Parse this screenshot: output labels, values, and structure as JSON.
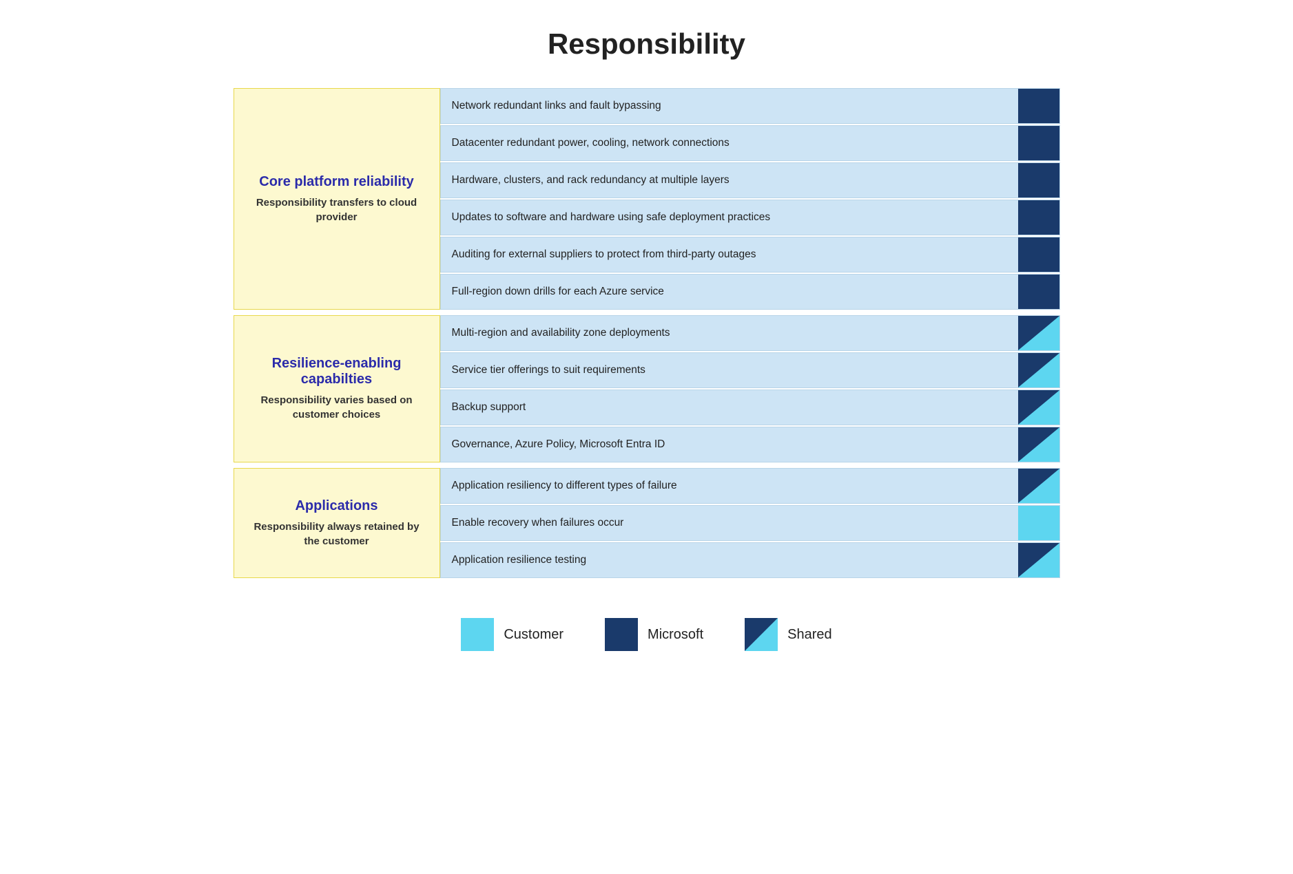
{
  "title": "Responsibility",
  "sections": [
    {
      "id": "core-platform",
      "title": "Core platform reliability",
      "subtitle": "Responsibility transfers\nto cloud provider",
      "items": [
        {
          "text": "Network redundant links and fault bypassing",
          "indicator": "microsoft"
        },
        {
          "text": "Datacenter redundant power, cooling, network connections",
          "indicator": "microsoft"
        },
        {
          "text": "Hardware, clusters, and rack redundancy at multiple layers",
          "indicator": "microsoft"
        },
        {
          "text": "Updates to software and hardware using safe deployment practices",
          "indicator": "microsoft"
        },
        {
          "text": "Auditing for external suppliers to protect from third-party outages",
          "indicator": "microsoft"
        },
        {
          "text": "Full-region down drills for each Azure service",
          "indicator": "microsoft"
        }
      ]
    },
    {
      "id": "resilience-enabling",
      "title": "Resilience-enabling capabilties",
      "subtitle": "Responsibility varies based\non customer choices",
      "items": [
        {
          "text": "Multi-region and availability zone deployments",
          "indicator": "shared"
        },
        {
          "text": "Service tier offerings to suit requirements",
          "indicator": "shared"
        },
        {
          "text": "Backup support",
          "indicator": "shared"
        },
        {
          "text": "Governance, Azure Policy, Microsoft Entra ID",
          "indicator": "shared"
        }
      ]
    },
    {
      "id": "applications",
      "title": "Applications",
      "subtitle": "Responsibility always\nretained by the customer",
      "items": [
        {
          "text": "Application resiliency to different types of failure",
          "indicator": "shared"
        },
        {
          "text": "Enable recovery when failures occur",
          "indicator": "customer"
        },
        {
          "text": "Application resilience testing",
          "indicator": "shared"
        }
      ]
    }
  ],
  "legend": {
    "items": [
      {
        "type": "customer",
        "label": "Customer"
      },
      {
        "type": "microsoft",
        "label": "Microsoft"
      },
      {
        "type": "shared",
        "label": "Shared"
      }
    ]
  }
}
